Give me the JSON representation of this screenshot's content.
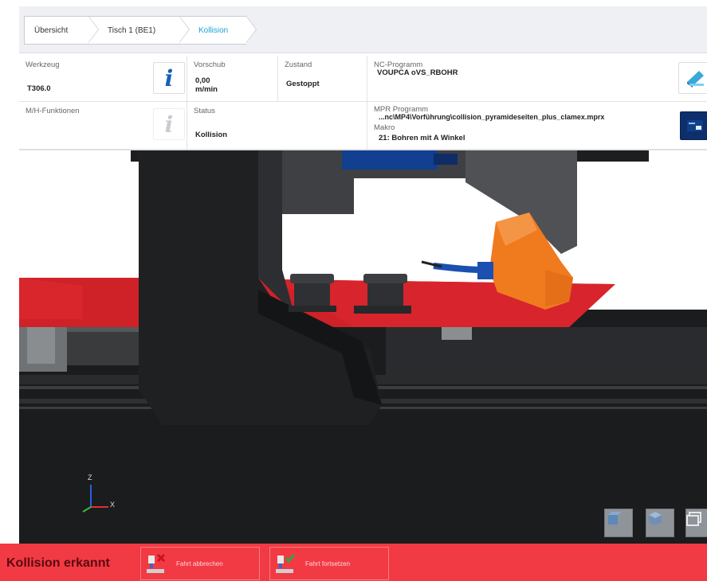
{
  "breadcrumb": [
    "Übersicht",
    "Tisch 1 (BE1)",
    "Kollision"
  ],
  "info": {
    "werkzeug_label": "Werkzeug",
    "werkzeug_value": "T306.0",
    "vorschub_label": "Vorschub",
    "vorschub_value": "0,00",
    "vorschub_unit": "m/min",
    "zustand_label": "Zustand",
    "zustand_value": "Gestoppt",
    "nc_label": "NC-Programm",
    "nc_value": "VOUPCA oVS_RBOHR",
    "mh_label": "M/H-Funktionen",
    "status_label": "Status",
    "status_value": "Kollision",
    "mpr_label": "MPR Programm",
    "mpr_value": "...nc\\MP4\\Vorführung\\collision_pyramideseiten_plus_clamex.mprx",
    "makro_label": "Makro",
    "makro_value": "21: Bohren mit A Winkel"
  },
  "axes": {
    "z": "Z",
    "x": "X"
  },
  "bottom": {
    "message": "Kollision erkannt",
    "btn_abort": "Fahrt abbrechen",
    "btn_continue": "Fahrt fortsetzen"
  },
  "colors": {
    "alert": "#f23a44",
    "link": "#1aa3d6",
    "info_icon": "#1560b8",
    "table": "#d8242c",
    "tool": "#f07a1e"
  }
}
